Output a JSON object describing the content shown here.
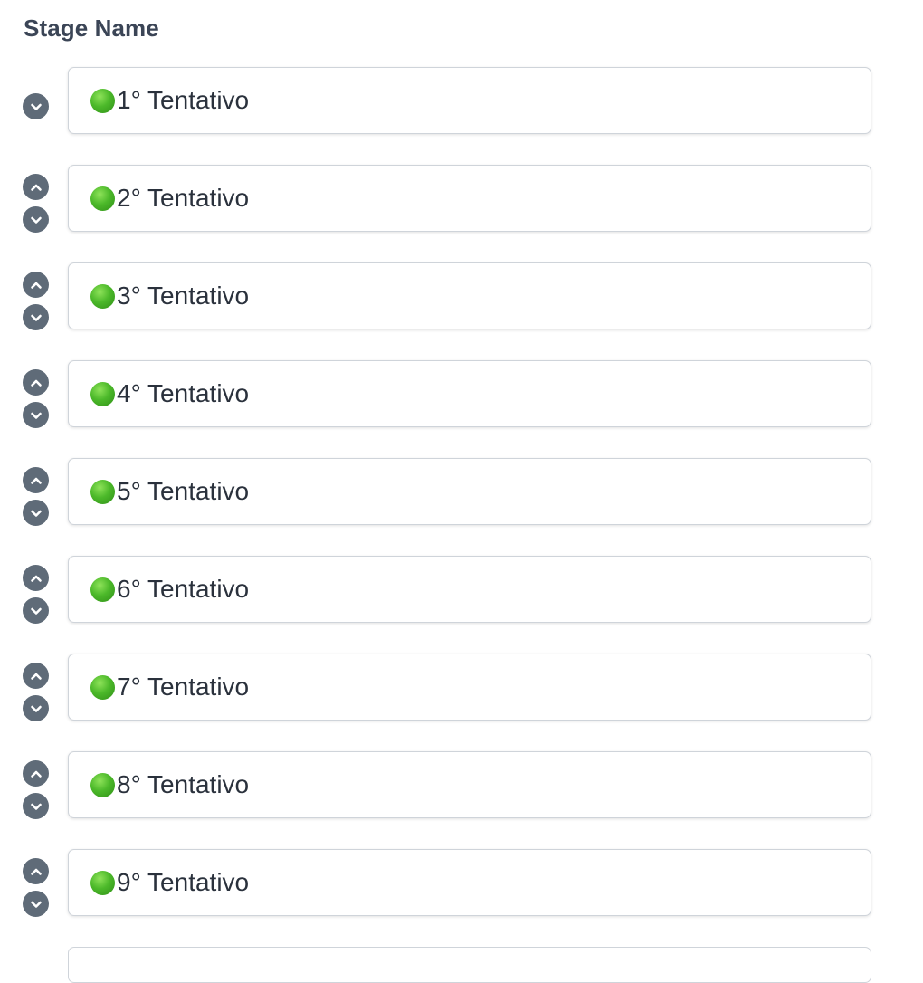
{
  "header": {
    "title": "Stage Name"
  },
  "stages": [
    {
      "label": "1° Tentativo",
      "status_icon": "green-circle-icon",
      "has_up": false,
      "has_down": true
    },
    {
      "label": "2° Tentativo",
      "status_icon": "green-circle-icon",
      "has_up": true,
      "has_down": true
    },
    {
      "label": "3° Tentativo",
      "status_icon": "green-circle-icon",
      "has_up": true,
      "has_down": true
    },
    {
      "label": "4° Tentativo",
      "status_icon": "green-circle-icon",
      "has_up": true,
      "has_down": true
    },
    {
      "label": "5° Tentativo",
      "status_icon": "green-circle-icon",
      "has_up": true,
      "has_down": true
    },
    {
      "label": "6° Tentativo",
      "status_icon": "green-circle-icon",
      "has_up": true,
      "has_down": true
    },
    {
      "label": "7° Tentativo",
      "status_icon": "green-circle-icon",
      "has_up": true,
      "has_down": true
    },
    {
      "label": "8° Tentativo",
      "status_icon": "green-circle-icon",
      "has_up": true,
      "has_down": true
    },
    {
      "label": "9° Tentativo",
      "status_icon": "green-circle-icon",
      "has_up": true,
      "has_down": true
    }
  ],
  "icons": {
    "move_up": "chevron-up-icon",
    "move_down": "chevron-down-icon"
  },
  "colors": {
    "control_button": "#5f6b78",
    "status_dot": "#4cb92a",
    "input_border": "#cfd4da",
    "header_text": "#3b4556"
  }
}
